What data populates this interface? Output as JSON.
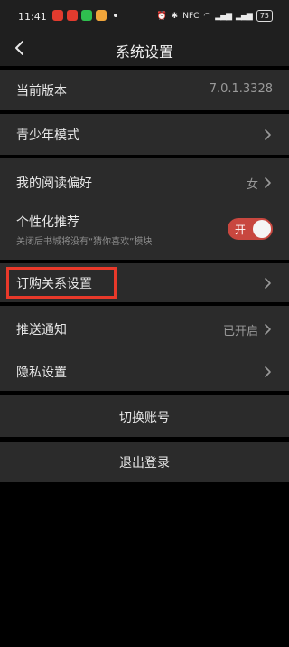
{
  "status_bar": {
    "time": "11:41",
    "app_icons": [
      {
        "name": "maps-app-icon",
        "color": "#e23b2e"
      },
      {
        "name": "news-app-icon",
        "color": "#e23b2e"
      },
      {
        "name": "message-app-icon",
        "color": "#2fbf4f"
      },
      {
        "name": "game-app-icon",
        "color": "#f0a53a"
      }
    ],
    "signal_1": "▂▄▆",
    "signal_2": "▂▄▆",
    "battery": "75",
    "network_badge": "NFC"
  },
  "header": {
    "title": "系统设置"
  },
  "rows": {
    "version": {
      "label": "当前版本",
      "value": "7.0.1.3328"
    },
    "youth_mode": {
      "label": "青少年模式"
    },
    "reading_pref": {
      "label": "我的阅读偏好",
      "value": "女"
    },
    "personalized": {
      "label": "个性化推荐",
      "subtitle": "关闭后书城将没有“猜你喜欢”模块",
      "toggle_label": "开",
      "toggle_on": true
    },
    "subscription": {
      "label": "订购关系设置"
    },
    "push": {
      "label": "推送通知",
      "value": "已开启"
    },
    "privacy": {
      "label": "隐私设置"
    }
  },
  "buttons": {
    "switch_account": "切换账号",
    "logout": "退出登录"
  },
  "colors": {
    "accent_toggle": "#c8473f",
    "highlight_box": "#e8392a"
  }
}
